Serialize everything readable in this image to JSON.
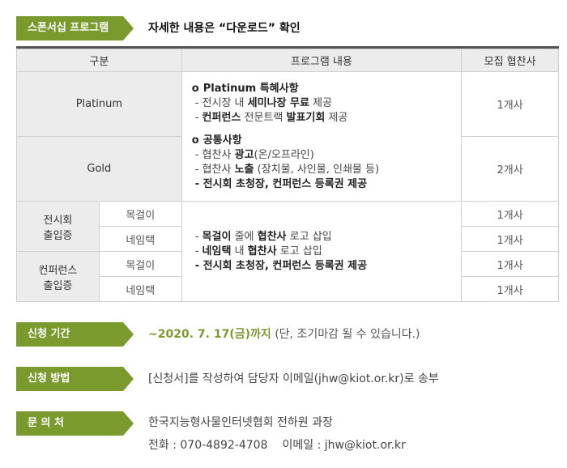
{
  "sponsorship": {
    "tag": "스폰서십 프로그램",
    "note": "자세한 내용은 “다운로드” 확인"
  },
  "table": {
    "headers": [
      "구분",
      "프로그램 내용",
      "모집 협찬사"
    ],
    "rows": {
      "platinum": {
        "label": "Platinum",
        "count": "1개사"
      },
      "gold": {
        "label": "Gold",
        "count": "2개사"
      },
      "exhibit_pass": {
        "label_line1": "전시회",
        "label_line2": "출입증",
        "lanyard": {
          "label": "목걸이",
          "count": "1개사"
        },
        "nametag": {
          "label": "네임택",
          "count": "1개사"
        }
      },
      "conference_pass": {
        "label_line1": "컨퍼런스",
        "label_line2": "출입증",
        "lanyard": {
          "label": "목걸이",
          "count": "1개사"
        },
        "nametag": {
          "label": "네임택",
          "count": "1개사"
        }
      }
    },
    "platinum_content": {
      "bullet": "o",
      "title": "Platinum 특혜사항",
      "item1_pre": "- 전시장 내 ",
      "item1_bold": "세미나장 무료",
      "item1_post": " 제공",
      "item2_pre": "- ",
      "item2_bold1": "컨퍼런스",
      "item2_mid": " 전문트랙 ",
      "item2_bold2": "발표기회",
      "item2_post": " 제공"
    },
    "common_content": {
      "bullet": "o",
      "title": "공통사항",
      "item1_pre": "- 협찬사 ",
      "item1_bold": "광고",
      "item1_post": "(온/오프라인)",
      "item2_pre": "- 협찬사 ",
      "item2_bold": "노출",
      "item2_post": " (장치물, 사인물, 인쇄물 등)",
      "item3": "- 전시회 초청장, 컨퍼런스 등록권 제공"
    },
    "pass_content": {
      "item1_pre": "- ",
      "item1_bold1": "목걸이",
      "item1_mid": " 줄에 ",
      "item1_bold2": "협찬사",
      "item1_post": " 로고 삽입",
      "item2_pre": "- ",
      "item2_bold1": "네임택",
      "item2_mid": " 내 ",
      "item2_bold2": "협찬사",
      "item2_post": " 로고 삽입",
      "item3": "- 전시회 초청장, 컨퍼런스 등록권 제공"
    }
  },
  "period": {
    "tag": "신청 기간",
    "main": "~2020. 7. 17(금)까지",
    "note": " (단, 조기마감 될 수 있습니다.)"
  },
  "method": {
    "tag": "신청 방법",
    "text": "[신청서]를 작성하여 담당자 이메일(jhw@kiot.or.kr)로 송부"
  },
  "contact": {
    "tag": "문 의 처",
    "org": "한국지능형사물인터넷협회 전하원 과장",
    "phone": "전화 : 070-4892-4708",
    "email": "이메일 : jhw@kiot.or.kr"
  },
  "colors": {
    "accent": "#7a9a2e",
    "header_bg": "#ececec",
    "border": "#cfcfcf"
  }
}
